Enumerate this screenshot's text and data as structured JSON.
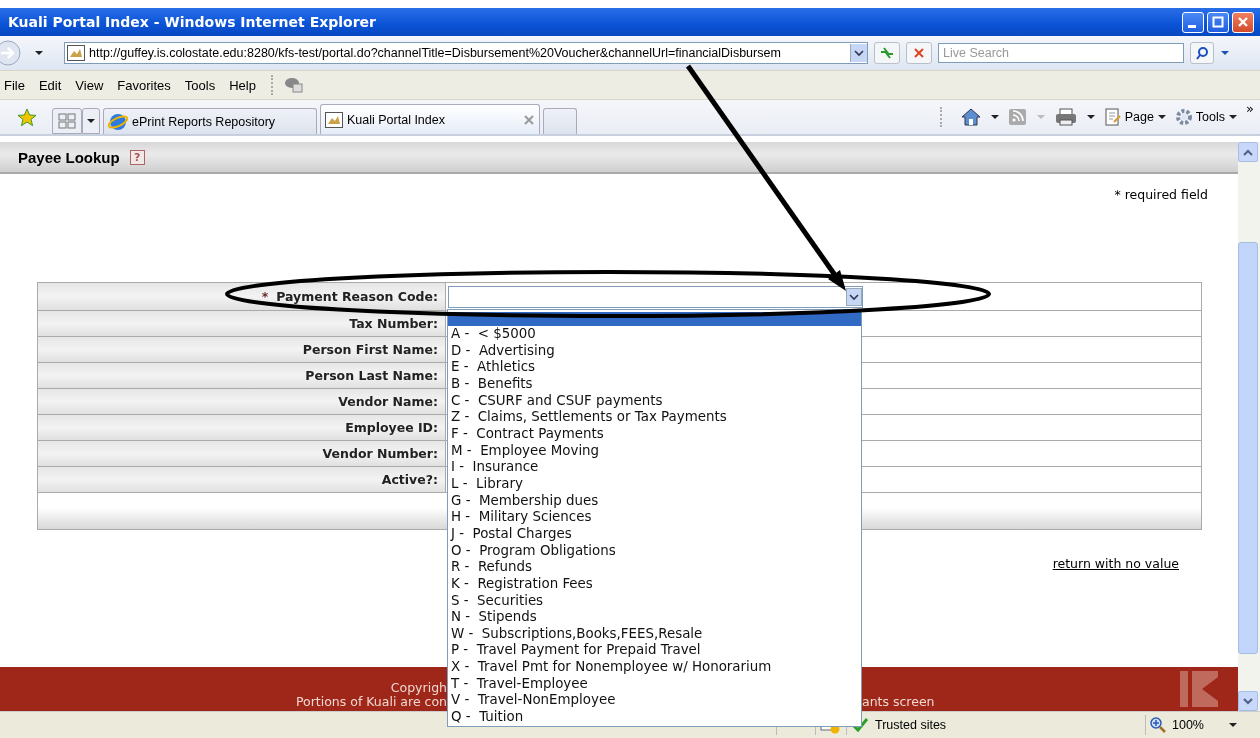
{
  "window": {
    "title": "Kuali Portal Index - Windows Internet Explorer"
  },
  "address_bar": {
    "url": "http://guffey.is.colostate.edu:8280/kfs-test/portal.do?channelTitle=Disbursement%20Voucher&channelUrl=financialDisbursem",
    "search_placeholder": "Live Search"
  },
  "menu": [
    "File",
    "Edit",
    "View",
    "Favorites",
    "Tools",
    "Help"
  ],
  "tabs": [
    {
      "label": "ePrint Reports Repository",
      "selected": false
    },
    {
      "label": "Kuali Portal Index",
      "selected": true
    }
  ],
  "command_bar": {
    "items": [
      "Page",
      "Tools"
    ],
    "overflow": "»"
  },
  "page": {
    "title": "Payee Lookup",
    "help": "?",
    "required_note": "* required field",
    "fields": [
      {
        "label": "Payment Reason Code:",
        "marker": "*",
        "kind": "select"
      },
      {
        "label": "Tax Number:",
        "kind": "text"
      },
      {
        "label": "Person First Name:",
        "kind": "text"
      },
      {
        "label": "Person Last Name:",
        "kind": "text"
      },
      {
        "label": "Vendor Name:",
        "kind": "text"
      },
      {
        "label": "Employee ID:",
        "kind": "text"
      },
      {
        "label": "Vendor Number:",
        "kind": "text"
      },
      {
        "label": "Active?:",
        "kind": "text"
      }
    ],
    "return_link": "return with no value"
  },
  "dropdown": {
    "blank_selected": true,
    "options": [
      {
        "label": "A -  < $5000",
        "selected": false
      },
      {
        "label": "D -  Advertising",
        "selected": false
      },
      {
        "label": "E -  Athletics",
        "selected": false
      },
      {
        "label": "B -  Benefits",
        "selected": false
      },
      {
        "label": "C -  CSURF and CSUF payments",
        "selected": false
      },
      {
        "label": "Z -  Claims, Settlements or Tax Payments",
        "selected": false
      },
      {
        "label": "F -  Contract Payments",
        "selected": false
      },
      {
        "label": "M -  Employee Moving",
        "selected": false
      },
      {
        "label": "I -  Insurance",
        "selected": false
      },
      {
        "label": "L -  Library",
        "selected": false
      },
      {
        "label": "G -  Membership dues",
        "selected": false
      },
      {
        "label": "H -  Military Sciences",
        "selected": false
      },
      {
        "label": "J -  Postal Charges",
        "selected": false
      },
      {
        "label": "O -  Program Obligations",
        "selected": false
      },
      {
        "label": "R -  Refunds",
        "selected": false
      },
      {
        "label": "K -  Registration Fees",
        "selected": false
      },
      {
        "label": "S -  Securities",
        "selected": false
      },
      {
        "label": "N -  Stipends",
        "selected": false
      },
      {
        "label": "W -  Subscriptions,Books,FEES,Resale",
        "selected": false
      },
      {
        "label": "P -  Travel Payment for Prepaid Travel",
        "selected": false
      },
      {
        "label": "X -  Travel Pmt for Nonemployee w/ Honorarium",
        "selected": false
      },
      {
        "label": "T -  Travel-Employee",
        "selected": false
      },
      {
        "label": "V -  Travel-NonEmployee",
        "selected": false
      },
      {
        "label": "Q -  Tuition",
        "selected": false
      }
    ]
  },
  "footer": {
    "line_1": "Copyrigh",
    "line_2_left": "Portions of Kuali are con",
    "line_2_right": "ants screen"
  },
  "status_bar": {
    "zone": "Trusted sites",
    "zoom": "100%"
  }
}
